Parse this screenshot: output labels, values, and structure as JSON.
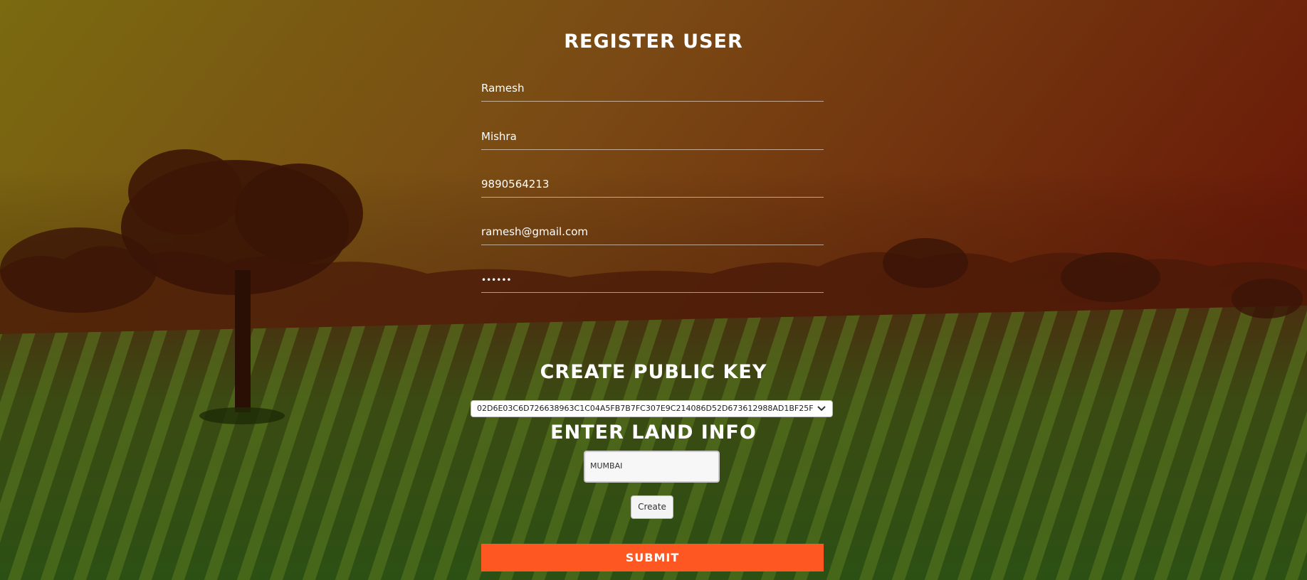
{
  "register": {
    "title": "REGISTER USER",
    "first_name": "Ramesh",
    "last_name": "Mishra",
    "phone": "9890564213",
    "email": "ramesh@gmail.com",
    "password_mask": "••••••"
  },
  "public_key": {
    "title": "CREATE PUBLIC KEY",
    "selected": "02D6E03C6D726638963C1C04A5FB7B7FC307E9C214086D52D673612988AD1BF25F",
    "dropdown_icon": "chevron-down-icon"
  },
  "land": {
    "title": "ENTER LAND INFO",
    "value": "MUMBAI",
    "create_label": "Create"
  },
  "submit_label": "SUBMIT",
  "colors": {
    "submit": "#ff5722"
  }
}
